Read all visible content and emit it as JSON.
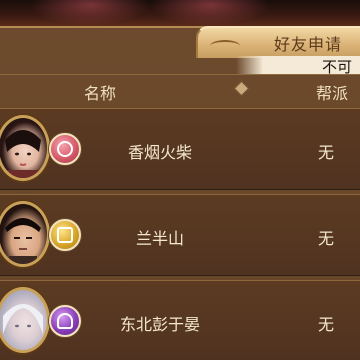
{
  "tab": {
    "label": "好友申请"
  },
  "subbar": {
    "text": "不可"
  },
  "header": {
    "name_col": "名称",
    "guild_col": "帮派"
  },
  "colors": {
    "panel": "#6a4829",
    "row": "#55371f",
    "gold_border": "#c9a057",
    "text": "#f6e8cf",
    "badge_red": "#d65b6b",
    "badge_gold": "#d8a72b",
    "badge_purple": "#8a3fb8"
  },
  "players": [
    {
      "name": "香烟火柴",
      "guild": "无",
      "badge_icon": "red-faction-badge-icon",
      "avatar_icon": "female-avatar-icon"
    },
    {
      "name": "兰半山",
      "guild": "无",
      "badge_icon": "gold-faction-badge-icon",
      "avatar_icon": "male-avatar-icon"
    },
    {
      "name": "东北彭于晏",
      "guild": "无",
      "badge_icon": "purple-faction-badge-icon",
      "avatar_icon": "silver-hair-avatar-icon"
    }
  ]
}
